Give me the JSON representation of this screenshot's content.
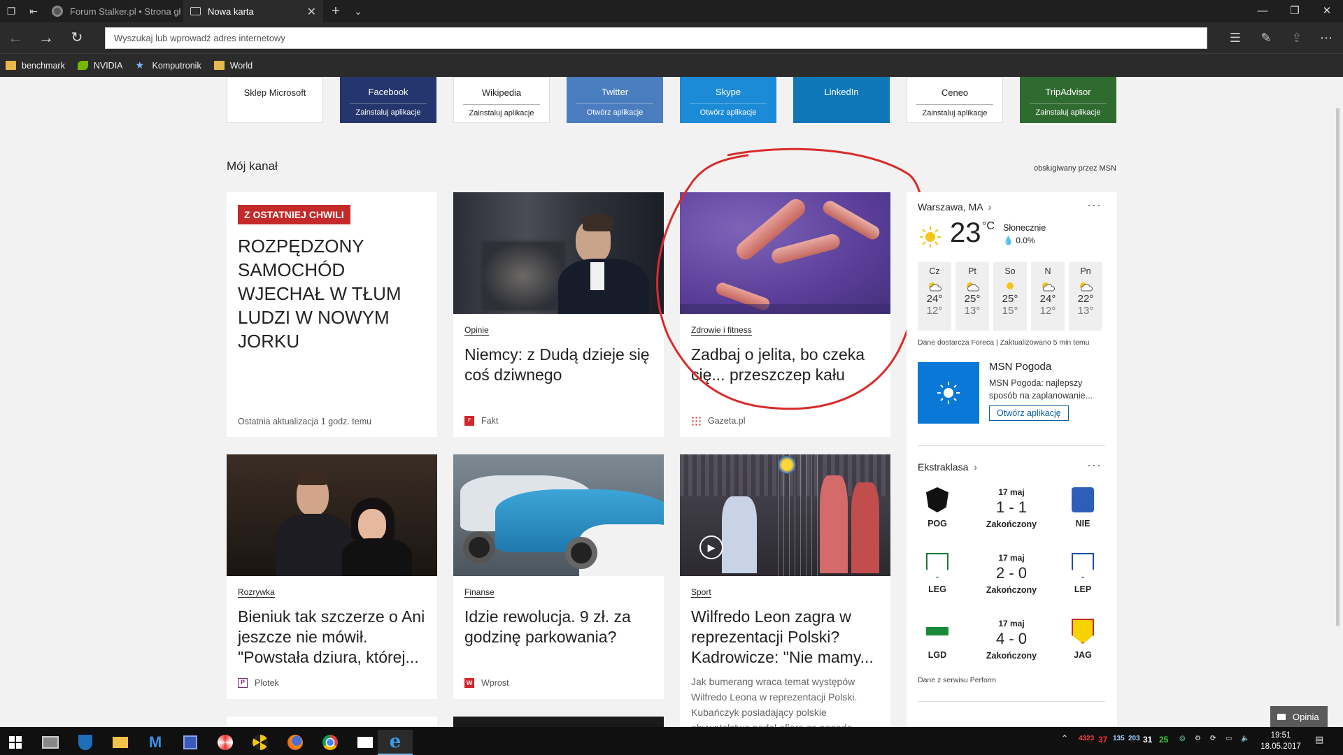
{
  "tabs": [
    {
      "title": "Forum Stalker.pl • Strona gł"
    },
    {
      "title": "Nowa karta"
    }
  ],
  "address_bar": {
    "placeholder": "Wyszukaj lub wprowadź adres internetowy"
  },
  "favorites": [
    {
      "label": "benchmark",
      "icon": "folder-icon"
    },
    {
      "label": "NVIDIA",
      "icon": "nvidia-icon"
    },
    {
      "label": "Komputronik",
      "icon": "star-icon"
    },
    {
      "label": "World",
      "icon": "folder-icon"
    }
  ],
  "tiles": [
    {
      "name": "Sklep Microsoft",
      "action": "",
      "bg": "#ffffff",
      "fg": "#222222"
    },
    {
      "name": "Facebook",
      "action": "Zainstaluj aplikacje",
      "bg": "#25356d",
      "fg": "#ffffff"
    },
    {
      "name": "Wikipedia",
      "action": "Zainstaluj aplikacje",
      "bg": "#ffffff",
      "fg": "#222222"
    },
    {
      "name": "Twitter",
      "action": "Otwórz aplikacje",
      "bg": "#4a7dc0",
      "fg": "#ffffff"
    },
    {
      "name": "Skype",
      "action": "Otwórz aplikacje",
      "bg": "#1c8ad6",
      "fg": "#ffffff"
    },
    {
      "name": "LinkedIn",
      "action": "",
      "bg": "#0d77b8",
      "fg": "#ffffff"
    },
    {
      "name": "Ceneo",
      "action": "Zainstaluj aplikacje",
      "bg": "#ffffff",
      "fg": "#222222"
    },
    {
      "name": "TripAdvisor",
      "action": "Zainstaluj aplikacje",
      "bg": "#2f6b2f",
      "fg": "#ffffff"
    }
  ],
  "feed": {
    "title": "Mój kanał",
    "powered_by": "obsługiwany przez MSN",
    "breaking": {
      "badge": "Z OSTATNIEJ CHWILI",
      "headline": "ROZPĘDZONY SAMOCHÓD WJECHAŁ W TŁUM LUDZI W NOWYM JORKU",
      "updated": "Ostatnia aktualizacja 1 godz. temu"
    },
    "cards": [
      {
        "category": "Opinie",
        "headline": "Niemcy: z Dudą dzieje się coś dziwnego",
        "source": "Fakt"
      },
      {
        "category": "Zdrowie i fitness",
        "headline": "Zadbaj o jelita, bo czeka cię... przeszczep kału",
        "source": "Gazeta.pl"
      },
      {
        "category": "Rozrywka",
        "headline": "Bieniuk tak szczerze o Ani jeszcze nie mówił. \"Powstała dziura, której...",
        "source": "Plotek"
      },
      {
        "category": "Finanse",
        "headline": "Idzie rewolucja. 9 zł. za godzinę parkowania?",
        "source": "Wprost"
      },
      {
        "category": "Sport",
        "headline": "Wilfredo Leon zagra w reprezentacji Polski? Kadrowicze: \"Nie mamy...",
        "snippet": "Jak bumerang wraca temat występów Wilfredo Leona w reprezentacji Polski. Kubańczyk posiadający polskie obywatelstwo padał ofiarą za pogodą..."
      }
    ]
  },
  "weather": {
    "location": "Warszawa, MA",
    "temp": "23",
    "unit": "°C",
    "condition": "Słonecznie",
    "precip": "0.0%",
    "days": [
      {
        "d": "Cz",
        "hi": "24°",
        "lo": "12°"
      },
      {
        "d": "Pt",
        "hi": "25°",
        "lo": "13°"
      },
      {
        "d": "So",
        "hi": "25°",
        "lo": "15°"
      },
      {
        "d": "N",
        "hi": "24°",
        "lo": "12°"
      },
      {
        "d": "Pn",
        "hi": "22°",
        "lo": "13°"
      }
    ],
    "footer": "Dane dostarcza Foreca | Zaktualizowano 5 min temu",
    "app": {
      "title": "MSN Pogoda",
      "desc": "MSN Pogoda: najlepszy sposób na zaplanowanie...",
      "button": "Otwórz aplikację"
    }
  },
  "sports": {
    "league": "Ekstraklasa",
    "matches": [
      {
        "date": "17 maj",
        "score": "1 - 1",
        "status": "Zakończony",
        "home": "POG",
        "away": "NIE"
      },
      {
        "date": "17 maj",
        "score": "2 - 0",
        "status": "Zakończony",
        "home": "LEG",
        "away": "LEP"
      },
      {
        "date": "17 maj",
        "score": "4 - 0",
        "status": "Zakończony",
        "home": "LGD",
        "away": "JAG"
      }
    ],
    "footer": "Dane z serwisu Perform"
  },
  "feedback_label": "Opinia",
  "tray": {
    "values": [
      {
        "v": "4323",
        "color": "#ff4040"
      },
      {
        "v": "37",
        "color": "#ff3030"
      },
      {
        "v": "135",
        "color": "#9fd0ff"
      },
      {
        "v": "203",
        "color": "#9fd0ff"
      },
      {
        "v": "31",
        "color": "#ffffff"
      },
      {
        "v": "25",
        "color": "#3ed13e"
      }
    ],
    "time": "19:51",
    "date": "18.05.2017"
  }
}
